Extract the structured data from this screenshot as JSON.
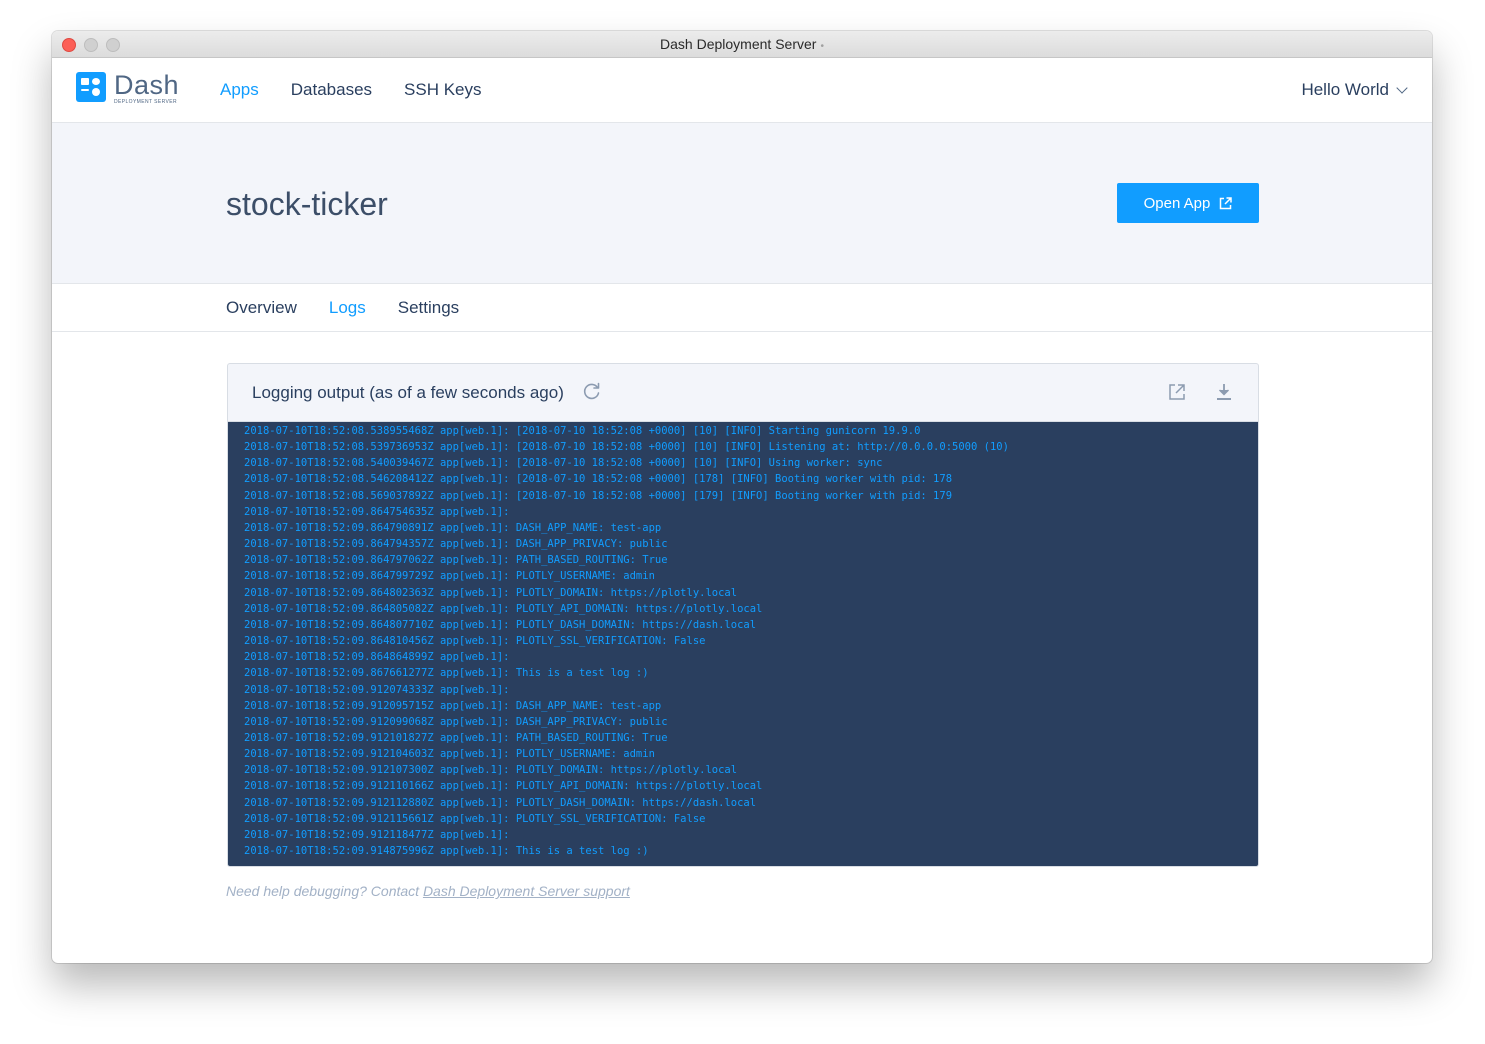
{
  "window": {
    "title": "Dash Deployment Server",
    "title_marker": "•"
  },
  "brand": {
    "name": "Dash",
    "subtitle": "DEPLOYMENT SERVER",
    "color": "#119dff"
  },
  "nav": {
    "items": [
      {
        "label": "Apps",
        "active": true
      },
      {
        "label": "Databases",
        "active": false
      },
      {
        "label": "SSH Keys",
        "active": false
      }
    ],
    "user": "Hello World",
    "user_icon": "chevron-down-icon"
  },
  "app": {
    "name": "stock-ticker",
    "open_button_label": "Open App",
    "open_button_icon": "external-link-icon"
  },
  "tabs": [
    {
      "label": "Overview",
      "active": false
    },
    {
      "label": "Logs",
      "active": true
    },
    {
      "label": "Settings",
      "active": false
    }
  ],
  "logs": {
    "title": "Logging output (as of a few seconds ago)",
    "icons": [
      "refresh-icon",
      "external-link-icon",
      "download-icon"
    ],
    "lines": [
      "2018-07-10T18:52:08.538955468Z app[web.1]: [2018-07-10 18:52:08 +0000] [10] [INFO] Starting gunicorn 19.9.0",
      "2018-07-10T18:52:08.539736953Z app[web.1]: [2018-07-10 18:52:08 +0000] [10] [INFO] Listening at: http://0.0.0.0:5000 (10)",
      "2018-07-10T18:52:08.540039467Z app[web.1]: [2018-07-10 18:52:08 +0000] [10] [INFO] Using worker: sync",
      "2018-07-10T18:52:08.546208412Z app[web.1]: [2018-07-10 18:52:08 +0000] [178] [INFO] Booting worker with pid: 178",
      "2018-07-10T18:52:08.569037892Z app[web.1]: [2018-07-10 18:52:08 +0000] [179] [INFO] Booting worker with pid: 179",
      "2018-07-10T18:52:09.864754635Z app[web.1]:",
      "2018-07-10T18:52:09.864790891Z app[web.1]: DASH_APP_NAME: test-app",
      "2018-07-10T18:52:09.864794357Z app[web.1]: DASH_APP_PRIVACY: public",
      "2018-07-10T18:52:09.864797062Z app[web.1]: PATH_BASED_ROUTING: True",
      "2018-07-10T18:52:09.864799729Z app[web.1]: PLOTLY_USERNAME: admin",
      "2018-07-10T18:52:09.864802363Z app[web.1]: PLOTLY_DOMAIN: https://plotly.local",
      "2018-07-10T18:52:09.864805082Z app[web.1]: PLOTLY_API_DOMAIN: https://plotly.local",
      "2018-07-10T18:52:09.864807710Z app[web.1]: PLOTLY_DASH_DOMAIN: https://dash.local",
      "2018-07-10T18:52:09.864810456Z app[web.1]: PLOTLY_SSL_VERIFICATION: False",
      "2018-07-10T18:52:09.864864899Z app[web.1]:",
      "2018-07-10T18:52:09.867661277Z app[web.1]: This is a test log :)",
      "2018-07-10T18:52:09.912074333Z app[web.1]:",
      "2018-07-10T18:52:09.912095715Z app[web.1]: DASH_APP_NAME: test-app",
      "2018-07-10T18:52:09.912099068Z app[web.1]: DASH_APP_PRIVACY: public",
      "2018-07-10T18:52:09.912101827Z app[web.1]: PATH_BASED_ROUTING: True",
      "2018-07-10T18:52:09.912104603Z app[web.1]: PLOTLY_USERNAME: admin",
      "2018-07-10T18:52:09.912107300Z app[web.1]: PLOTLY_DOMAIN: https://plotly.local",
      "2018-07-10T18:52:09.912110166Z app[web.1]: PLOTLY_API_DOMAIN: https://plotly.local",
      "2018-07-10T18:52:09.912112880Z app[web.1]: PLOTLY_DASH_DOMAIN: https://dash.local",
      "2018-07-10T18:52:09.912115661Z app[web.1]: PLOTLY_SSL_VERIFICATION: False",
      "2018-07-10T18:52:09.912118477Z app[web.1]:",
      "2018-07-10T18:52:09.914875996Z app[web.1]: This is a test log :)"
    ]
  },
  "help": {
    "text": "Need help debugging? Contact ",
    "link": "Dash Deployment Server support"
  },
  "colors": {
    "accent": "#119dff",
    "log_background": "#2a3f5f",
    "hero_background": "#f3f5fa"
  }
}
